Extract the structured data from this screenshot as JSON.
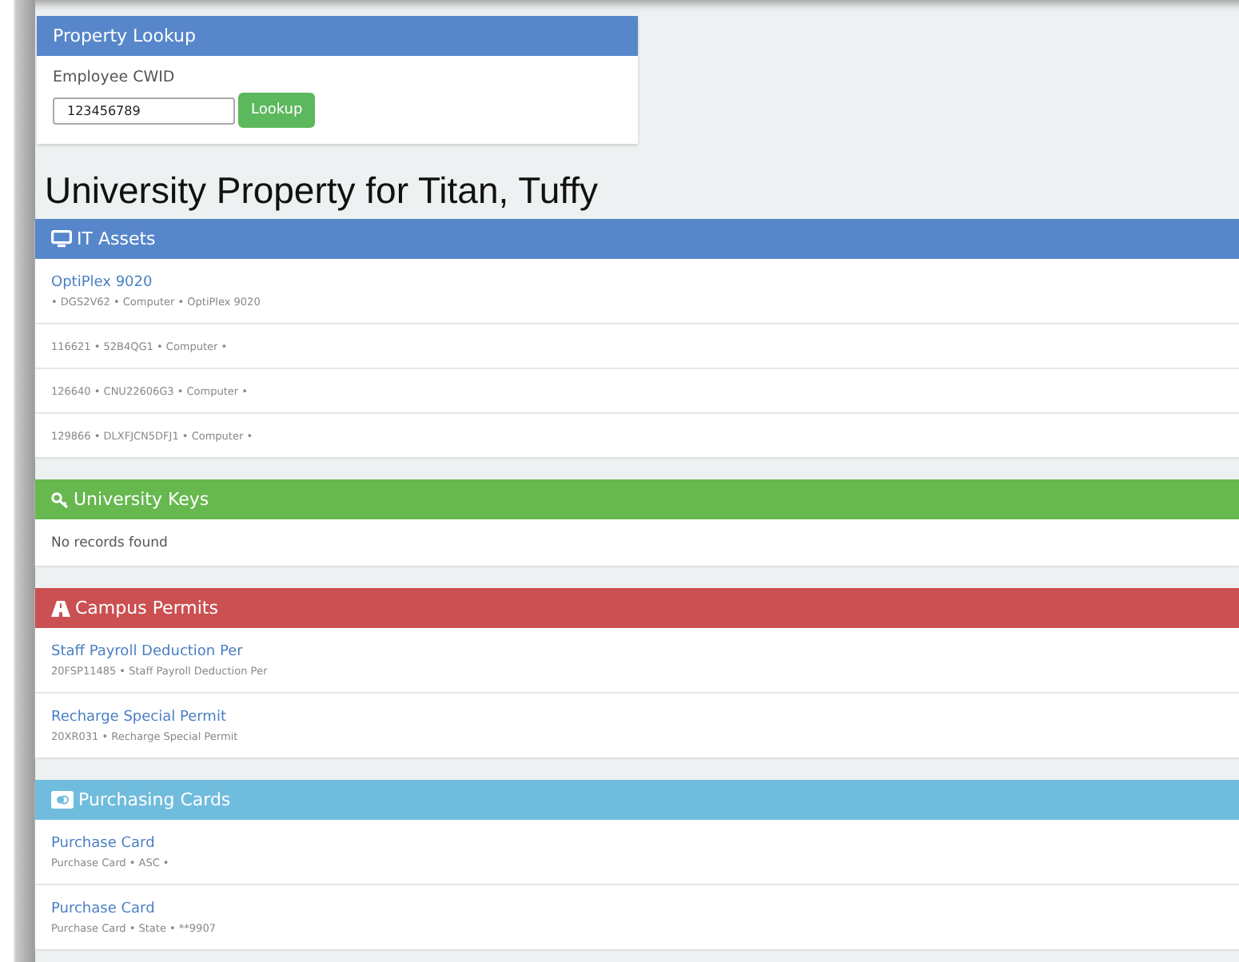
{
  "lookup": {
    "title": "Property Lookup",
    "label": "Employee CWID",
    "value": "123456789",
    "button": "Lookup"
  },
  "heading": "University Property for Titan, Tuffy",
  "sections": [
    {
      "title": "IT Assets",
      "kind": "monitor",
      "color": "#5787ca",
      "rows": [
        {
          "title": "OptiPlex 9020",
          "detail": "• DGS2V62 • Computer • OptiPlex 9020"
        },
        {
          "detail": "116621 • 52B4QG1 • Computer •"
        },
        {
          "detail": "126640 • CNU22606G3 • Computer •"
        },
        {
          "detail": "129866 • DLXFJCN5DFJ1 • Computer •"
        }
      ]
    },
    {
      "title": "University Keys",
      "kind": "key",
      "color": "#67b84f",
      "rows": [
        {
          "detail": "No records found"
        }
      ]
    },
    {
      "title": "Campus Permits",
      "kind": "road",
      "color": "#cb5051",
      "rows": [
        {
          "title": "Staff Payroll Deduction Per",
          "detail": "20FSP11485 • Staff Payroll Deduction Per"
        },
        {
          "title": "Recharge Special Permit",
          "detail": "20XR031 • Recharge Special Permit"
        }
      ]
    },
    {
      "title": "Purchasing Cards",
      "kind": "card",
      "color": "#70bcdd",
      "rows": [
        {
          "title": "Purchase Card",
          "detail": "Purchase Card • ASC •"
        },
        {
          "title": "Purchase Card",
          "detail": "Purchase Card • State • **9907"
        }
      ]
    }
  ]
}
